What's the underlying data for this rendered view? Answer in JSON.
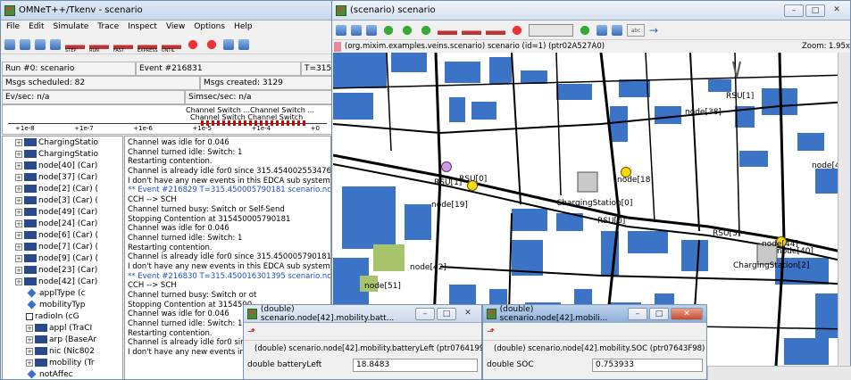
{
  "left_window": {
    "title": "OMNeT++/Tkenv - scenario",
    "menu": [
      "File",
      "Edit",
      "Simulate",
      "Trace",
      "Inspect",
      "View",
      "Options",
      "Help"
    ],
    "tool_labels": [
      "STEP",
      "RUN",
      "FAST",
      "EXPRESS",
      "UNTIL",
      "STOP",
      "REC"
    ],
    "status": {
      "run": "Run #0: scenario",
      "event": "Event #216831",
      "time": "T=315.4",
      "msgs_scheduled": "Msgs scheduled: 82",
      "msgs_created": "Msgs created: 3129",
      "ev_sec": "Ev/sec: n/a",
      "simsec_sec": "Simsec/sec: n/a"
    },
    "timeline": {
      "ticks": [
        "+1e-8",
        "+1e-7",
        "+1e-6",
        "+1e-5",
        "+1e-4",
        "+0"
      ],
      "labels": [
        "Channel Switch ...Channel Switch ...",
        "Channel Switch  Channel Switch"
      ]
    },
    "tree": [
      {
        "label": "ChargingStatio",
        "icon": "station"
      },
      {
        "label": "ChargingStatio",
        "icon": "station"
      },
      {
        "label": "node[40] (Car)",
        "icon": "car"
      },
      {
        "label": "node[37] (Car)",
        "icon": "car"
      },
      {
        "label": "node[2] (Car) (",
        "icon": "car"
      },
      {
        "label": "node[3] (Car) (",
        "icon": "car"
      },
      {
        "label": "node[49] (Car)",
        "icon": "car"
      },
      {
        "label": "node[24] (Car)",
        "icon": "car"
      },
      {
        "label": "node[6] (Car) (",
        "icon": "car"
      },
      {
        "label": "node[7] (Car) (",
        "icon": "car"
      },
      {
        "label": "node[9] (Car) (",
        "icon": "car"
      },
      {
        "label": "node[23] (Car)",
        "icon": "car"
      },
      {
        "label": "node[42] (Car)",
        "icon": "car"
      },
      {
        "label": "applType (c",
        "icon": "param"
      },
      {
        "label": "mobilityTyp",
        "icon": "param"
      },
      {
        "label": "radioIn (cG",
        "icon": "gate"
      },
      {
        "label": "appl (TraCI",
        "icon": "module"
      },
      {
        "label": "arp (BaseAr",
        "icon": "module"
      },
      {
        "label": "nic (Nic802",
        "icon": "module"
      },
      {
        "label": "mobility (Tr",
        "icon": "module"
      },
      {
        "label": "notAffec",
        "icon": "param"
      }
    ],
    "log": [
      {
        "t": "Channel was idle for 0.046",
        "ev": false
      },
      {
        "t": "Channel turned idle: Switch: 1",
        "ev": false
      },
      {
        "t": "Restarting contention.",
        "ev": false
      },
      {
        "t": "Channel is already idle for0 since 315.454002553476",
        "ev": false
      },
      {
        "t": "I don't have any new events in this EDCA sub system",
        "ev": false
      },
      {
        "t": "** Event #216829  T=315.450005790181  scenario.node[40",
        "ev": true
      },
      {
        "t": "CCH --> SCH",
        "ev": false
      },
      {
        "t": "Channel turned busy: Switch or Self-Send",
        "ev": false
      },
      {
        "t": "Stopping Contention at 315450005790181",
        "ev": false
      },
      {
        "t": "Channel was idle for 0.046",
        "ev": false
      },
      {
        "t": "Channel turned idle: Switch: 1",
        "ev": false
      },
      {
        "t": "Restarting contention.",
        "ev": false
      },
      {
        "t": "Channel is already idle for0 since 315.450005790181",
        "ev": false
      },
      {
        "t": "I don't have any new events in this EDCA sub system",
        "ev": false
      },
      {
        "t": "** Event #216830  T=315.450016301395  scenario.node[18",
        "ev": true
      },
      {
        "t": "CCH --> SCH",
        "ev": false
      },
      {
        "t": "Channel turned busy: Switch or ot",
        "ev": false
      },
      {
        "t": "Stopping Contention at 3154500",
        "ev": false
      },
      {
        "t": "Channel was idle for 0.046",
        "ev": false
      },
      {
        "t": "Channel turned idle: Switch: 1",
        "ev": false
      },
      {
        "t": "Restarting contention.",
        "ev": false
      },
      {
        "t": "Channel is already idle for0 sinc",
        "ev": false
      },
      {
        "t": "I don't have any new events in t",
        "ev": false
      }
    ]
  },
  "right_window": {
    "title": "(scenario) scenario",
    "path": "(org.mixim.examples.veins.scenario) scenario  (id=1)  (ptr02A527A0)",
    "zoom": "Zoom: 1.95x",
    "map_labels": [
      "RSU[1]",
      "node[38]",
      "node[43]",
      "RSU[1]",
      "RSU[0]",
      "node[19]",
      "ChargingStation[0]",
      "node[18]",
      "RSU[0]",
      "RSU[3]",
      "node[44]",
      "node[40]",
      "ChargingStation[2]",
      "node[42]",
      "node[51]"
    ]
  },
  "dialog_battery": {
    "title": "(double) scenario.node[42].mobility.batt...",
    "path": "(double) scenario.node[42].mobility.batteryLeft  (ptr07641998)",
    "field_label": "double batteryLeft",
    "value": "18.8483",
    "color": "#7b68ee"
  },
  "dialog_soc": {
    "title": "(double) scenario.node[42].mobili...",
    "path": "(double) scenario.node[42].mobility.SOC  (ptr07643F98)",
    "field_label": "double SOC",
    "value": "0.753933",
    "color": "#c0392b"
  },
  "colors": {
    "road": "#000000",
    "building": "#3b73c6",
    "park": "#a8c46a",
    "titlebar": "#c6d7ec",
    "event": "#1b50c8"
  }
}
